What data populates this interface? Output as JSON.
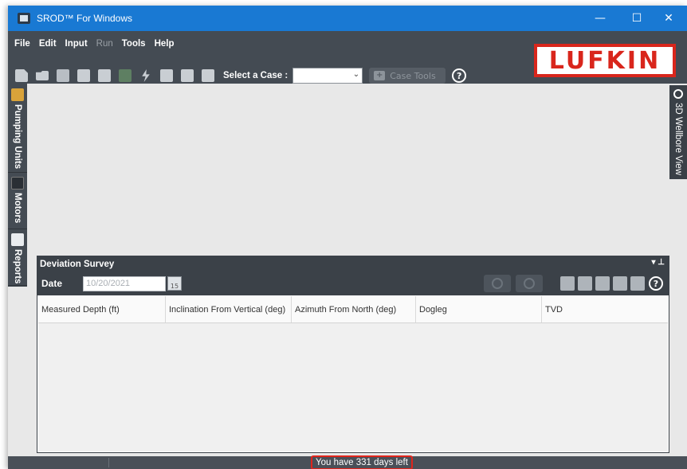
{
  "window": {
    "title": "SROD™ For Windows",
    "controls": {
      "minimize": "—",
      "maximize": "☐",
      "close": "✕"
    }
  },
  "menu": {
    "items": [
      {
        "label": "File",
        "enabled": true
      },
      {
        "label": "Edit",
        "enabled": true
      },
      {
        "label": "Input",
        "enabled": true
      },
      {
        "label": "Run",
        "enabled": false
      },
      {
        "label": "Tools",
        "enabled": true
      },
      {
        "label": "Help",
        "enabled": true
      }
    ]
  },
  "toolbar": {
    "select_case_label": "Select a Case :",
    "case_value": "",
    "case_tools_label": "Case Tools",
    "help_symbol": "?"
  },
  "logo": {
    "text": "LUFKIN",
    "color": "#d9261c"
  },
  "left_tabs": [
    {
      "label": "Pumping Units",
      "icon": "pump-jack-icon"
    },
    {
      "label": "Motors",
      "icon": "motor-icon"
    },
    {
      "label": "Reports",
      "icon": "chart-icon"
    }
  ],
  "right_tab": {
    "label": "3D Wellbore View",
    "icon": "wellbore-icon"
  },
  "deviation_panel": {
    "title": "Deviation Survey",
    "date_label": "Date",
    "date_value": "10/20/2021",
    "calendar_day": "15",
    "help_symbol": "?",
    "columns": [
      "Measured Depth (ft)",
      "Inclination From Vertical (deg)",
      "Azimuth From North (deg)",
      "Dogleg",
      "TVD"
    ],
    "rows": []
  },
  "status": {
    "message": "You have 331 days left"
  },
  "colors": {
    "titlebar": "#1979d3",
    "chrome": "#444b53",
    "alert": "#e0251c"
  }
}
